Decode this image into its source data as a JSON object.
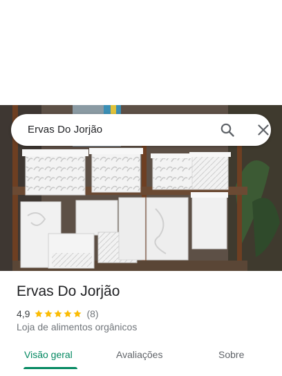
{
  "search": {
    "query": "Ervas Do Jorjão"
  },
  "place": {
    "name": "Ervas Do Jorjão",
    "rating": "4,9",
    "rating_stars": 5,
    "review_count": "(8)",
    "category": "Loja de alimentos orgânicos"
  },
  "tabs": [
    {
      "label": "Visão geral",
      "active": true
    },
    {
      "label": "Avaliações",
      "active": false
    },
    {
      "label": "Sobre",
      "active": false
    }
  ],
  "colors": {
    "accent": "#01875f",
    "star": "#fbbc04",
    "muted_text": "#70757a"
  },
  "icons": {
    "search": "search-icon",
    "close": "close-icon",
    "star": "star-icon"
  }
}
